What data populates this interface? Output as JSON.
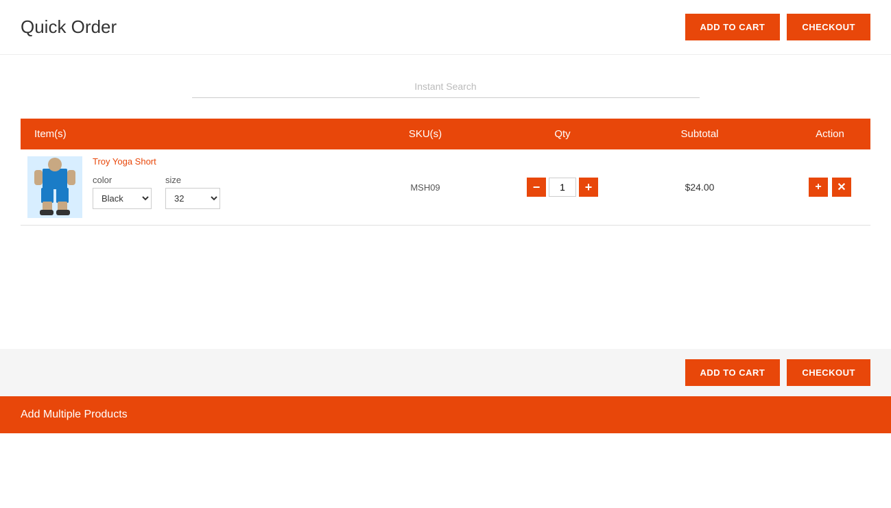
{
  "page": {
    "title": "Quick Order"
  },
  "header": {
    "add_to_cart_label": "ADD TO CART",
    "checkout_label": "CHECKOUT"
  },
  "search": {
    "placeholder": "Instant Search"
  },
  "table": {
    "columns": {
      "items": "Item(s)",
      "skus": "SKU(s)",
      "qty": "Qty",
      "subtotal": "Subtotal",
      "action": "Action"
    },
    "rows": [
      {
        "product_name": "Troy Yoga Short",
        "sku": "MSH09",
        "color_label": "color",
        "color_value": "Black",
        "size_label": "size",
        "size_value": "32",
        "qty": "1",
        "subtotal": "$24.00"
      }
    ]
  },
  "footer": {
    "add_to_cart_label": "ADD TO CART",
    "checkout_label": "CHECKOUT"
  },
  "add_multiple": {
    "label": "Add Multiple Products"
  },
  "colors": {
    "orange": "#e8470a",
    "white": "#ffffff",
    "light_gray": "#f5f5f5"
  }
}
